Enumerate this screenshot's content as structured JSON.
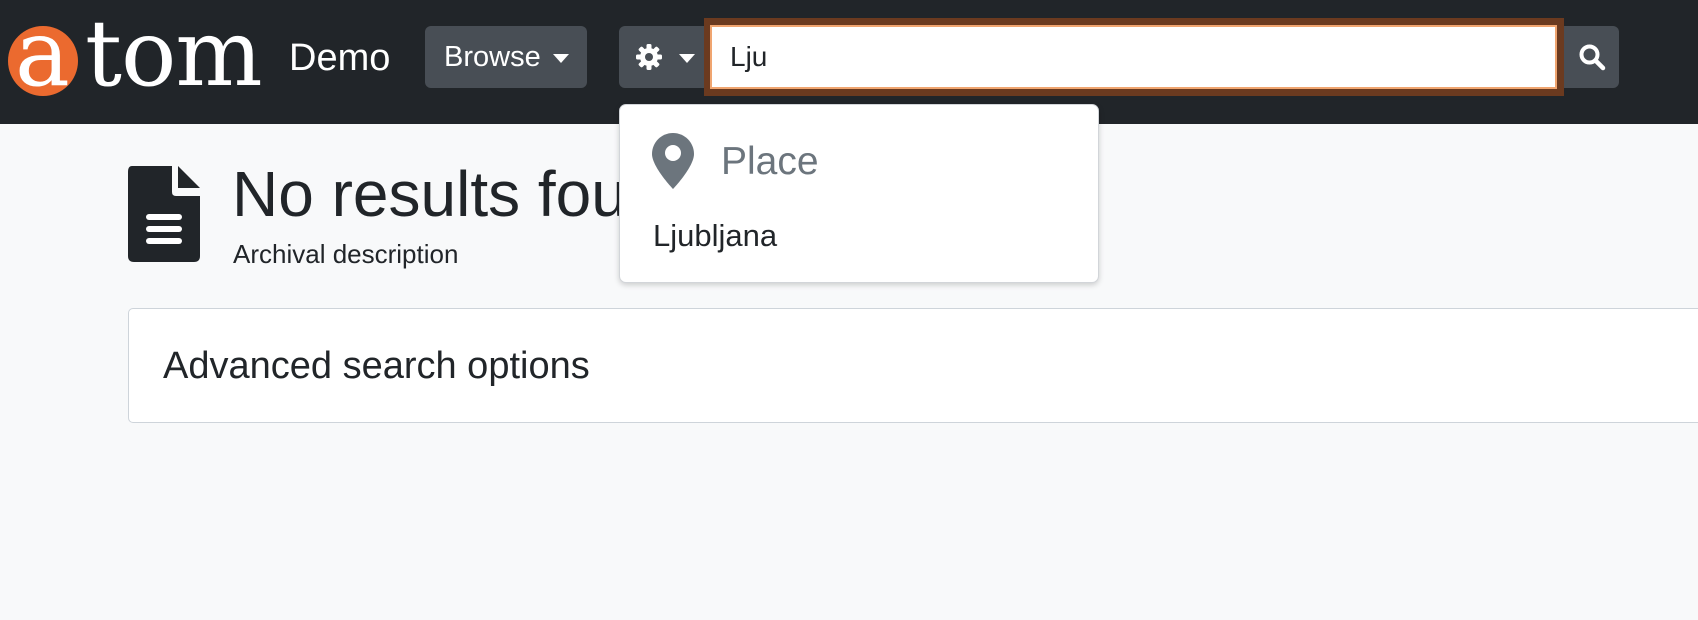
{
  "header": {
    "logo_first_letter": "a",
    "logo_rest": "tom",
    "site_name": "Demo",
    "browse_label": "Browse",
    "search_value": "Lju",
    "icons": {
      "options": "gear-icon",
      "search": "search-icon"
    }
  },
  "autocomplete": {
    "section_icon": "map-marker-icon",
    "section_title": "Place",
    "items": [
      "Ljubljana"
    ]
  },
  "main": {
    "title": "No results fou",
    "subtitle": "Archival description",
    "advanced_label": "Advanced search options"
  },
  "colors": {
    "navbar": "#212529",
    "logo_accent": "#eb6a2f",
    "button": "#484e55",
    "focus_ring": "#6b3a1f"
  }
}
